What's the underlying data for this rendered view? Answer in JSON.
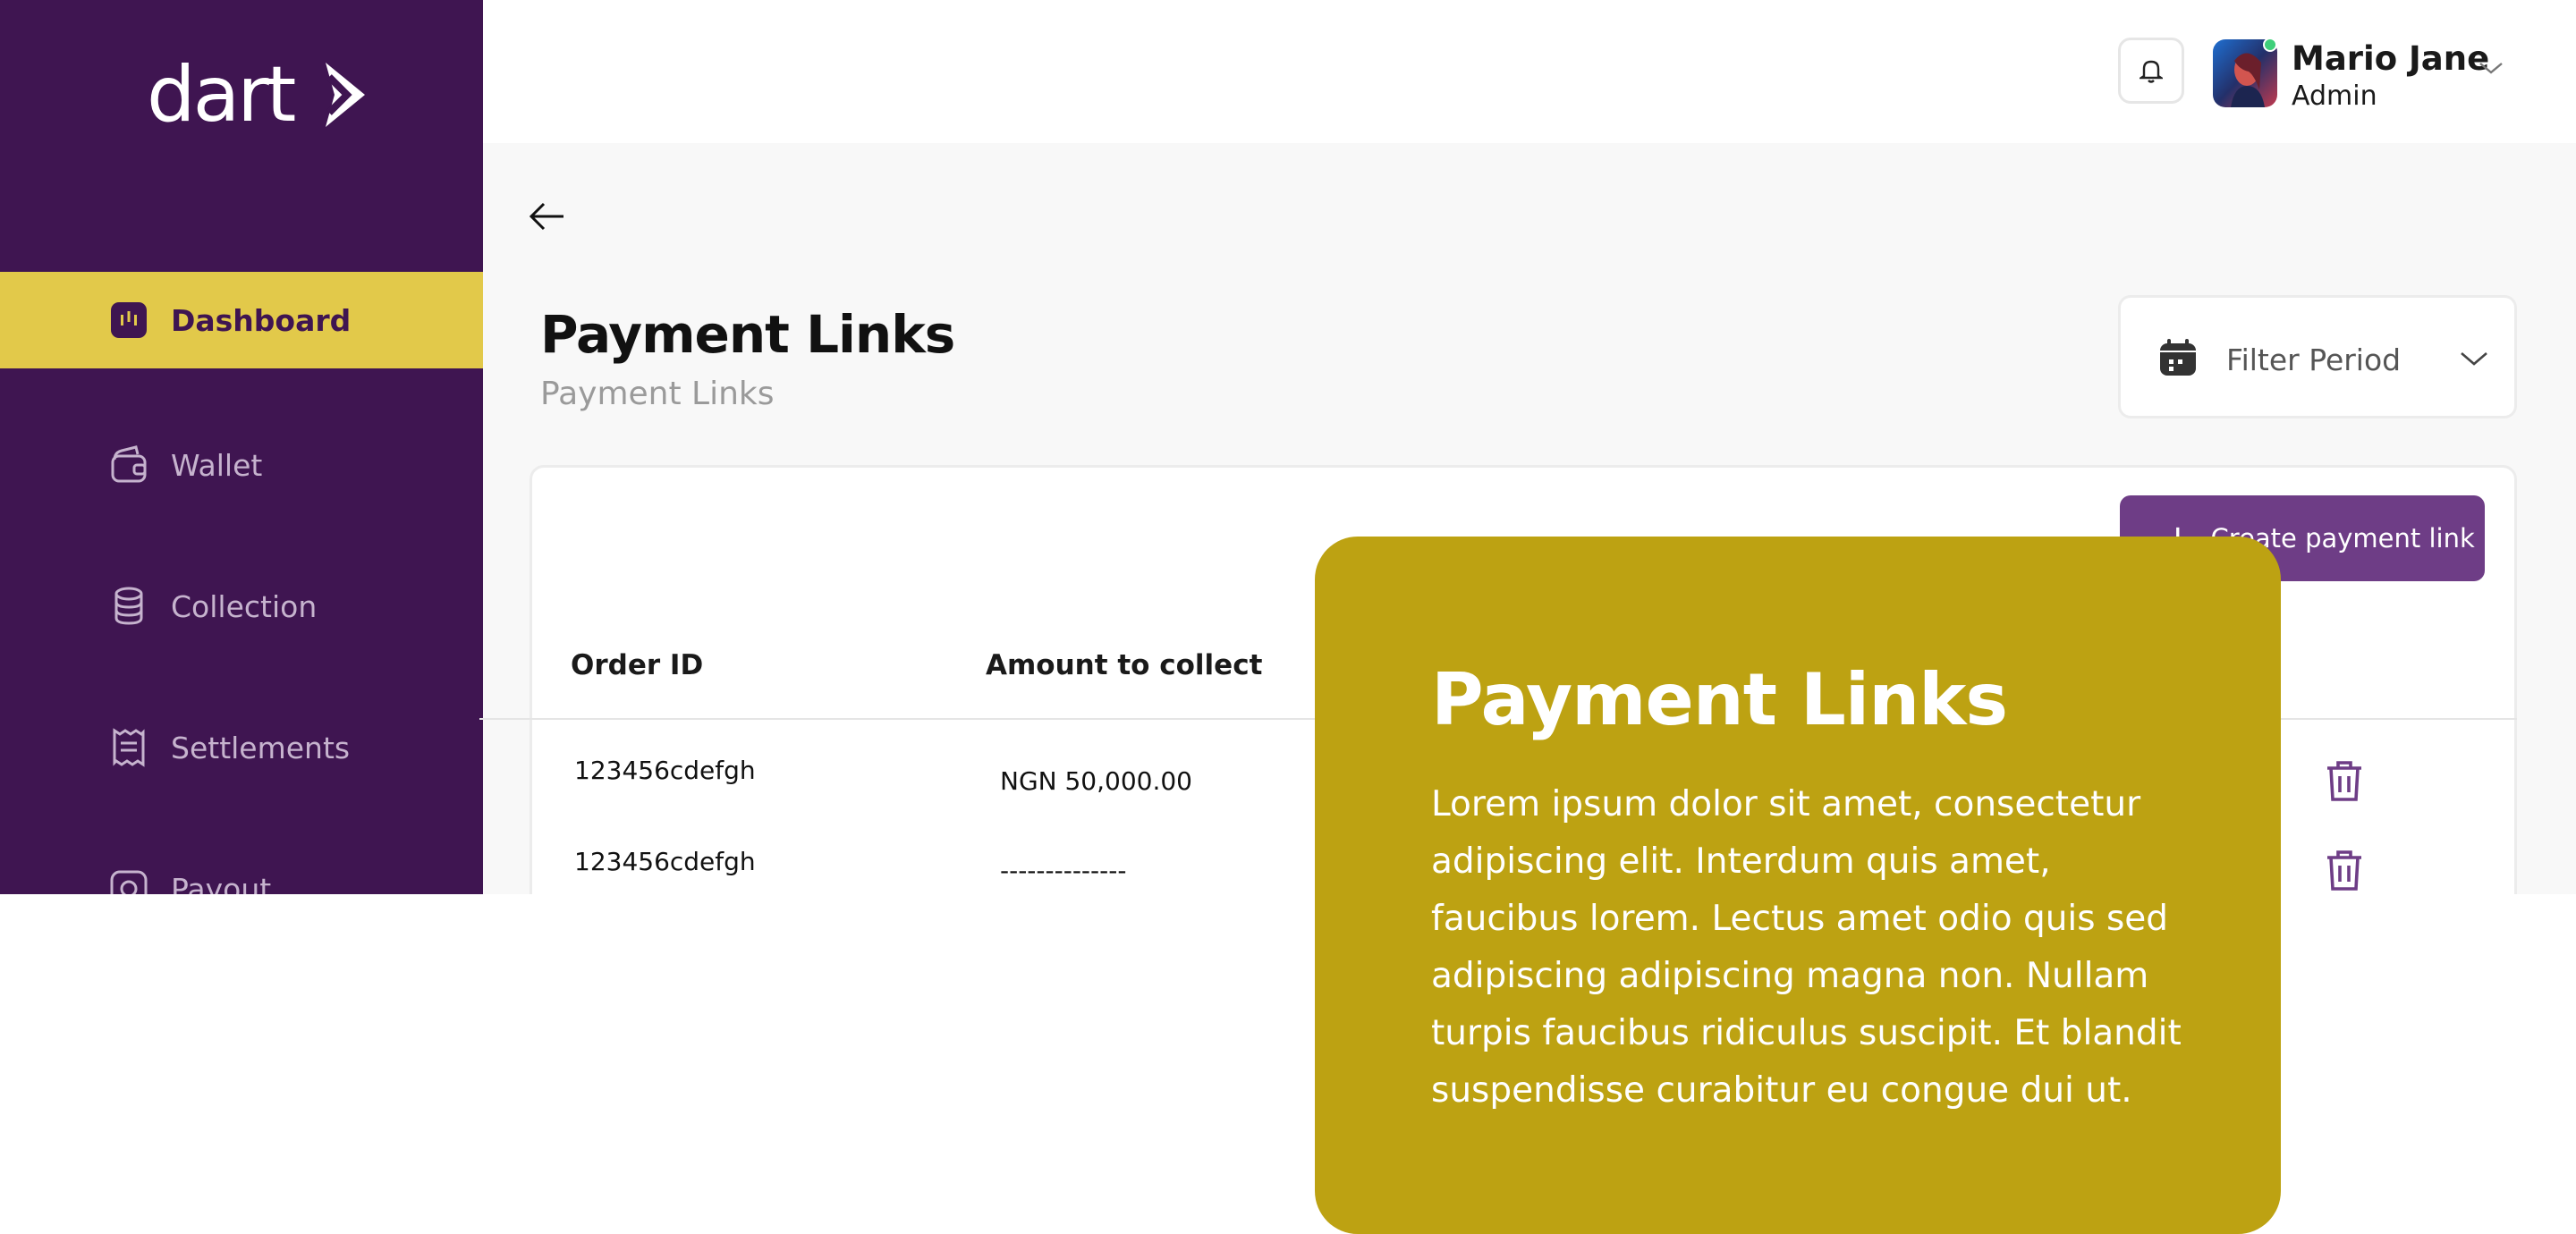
{
  "brand": {
    "logo_text": "dart"
  },
  "sidebar": {
    "items": [
      {
        "label": "Dashboard",
        "icon": "dashboard-icon",
        "active": true
      },
      {
        "label": "Wallet",
        "icon": "wallet-icon",
        "active": false
      },
      {
        "label": "Collection",
        "icon": "coins-icon",
        "active": false
      },
      {
        "label": "Settlements",
        "icon": "receipt-icon",
        "active": false
      },
      {
        "label": "Payout",
        "icon": "camera-icon",
        "active": false
      }
    ]
  },
  "header": {
    "user": {
      "name": "Mario Jane",
      "role": "Admin"
    }
  },
  "page": {
    "title": "Payment Links",
    "subtitle": "Payment Links",
    "filter_label": "Filter Period",
    "create_button_label": "Create payment link",
    "create_button_icon": "+"
  },
  "table": {
    "columns": [
      "Order ID",
      "Amount to collect"
    ],
    "rows": [
      {
        "order_id": "123456cdefgh",
        "amount": "NGN 50,000.00"
      },
      {
        "order_id": "123456cdefgh",
        "amount": "--------------"
      }
    ]
  },
  "overlay": {
    "title": "Payment Links",
    "body": "Lorem ipsum dolor sit amet, consectetur adipiscing elit. Interdum quis amet, faucibus lorem. Lectus amet odio quis sed adipiscing adipiscing magna non. Nullam turpis faucibus ridiculus suscipit. Et blandit suspendisse curabitur eu congue dui ut."
  },
  "colors": {
    "sidebar": "#3f1551",
    "active_nav": "#e2c94a",
    "button": "#6e3d86",
    "overlay": "#bda212",
    "online_dot": "#3ecf7a"
  }
}
